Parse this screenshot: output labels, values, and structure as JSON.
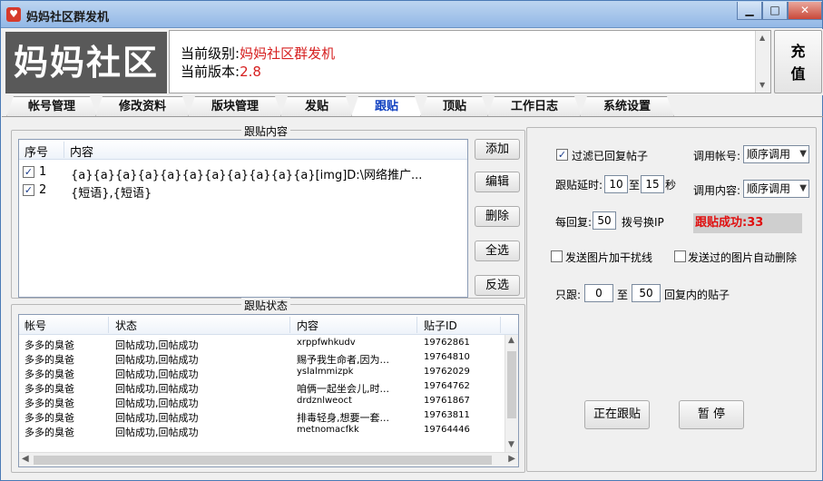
{
  "window": {
    "title": "妈妈社区群发机",
    "min_label": "▁",
    "max_label": "□",
    "close_label": "✕",
    "app_icon": "app-icon"
  },
  "header": {
    "logo": "妈妈社区",
    "level_label": "当前级别:",
    "level_value": "妈妈社区群发机",
    "version_label": "当前版本:",
    "version_value": "2.8",
    "recharge_label_1": "充",
    "recharge_label_2": "值"
  },
  "tabs": [
    "帐号管理",
    "修改资料",
    "版块管理",
    "发贴",
    "跟贴",
    "顶贴",
    "工作日志",
    "系统设置"
  ],
  "active_tab": "跟贴",
  "reply_content": {
    "title": "跟贴内容",
    "columns": [
      "序号",
      "内容"
    ],
    "rows": [
      {
        "no": "1",
        "checked": "✓",
        "content": "{a}{a}{a}{a}{a}{a}{a}{a}{a}{a}{a}[img]D:\\网络推广..."
      },
      {
        "no": "2",
        "checked": "✓",
        "content": "{短语},{短语}"
      }
    ],
    "buttons": {
      "add": "添加",
      "edit": "编辑",
      "delete": "删除",
      "select_all": "全选",
      "invert": "反选"
    }
  },
  "reply_status": {
    "title": "跟贴状态",
    "columns": [
      "帐号",
      "状态",
      "内容",
      "贴子ID"
    ],
    "rows": [
      {
        "account": "多多的臭爸",
        "status": "回帖成功,回帖成功",
        "content": "xrppfwhkudv",
        "post_id": "19762861"
      },
      {
        "account": "多多的臭爸",
        "status": "回帖成功,回帖成功",
        "content": "赐予我生命者,因为...",
        "post_id": "19764810"
      },
      {
        "account": "多多的臭爸",
        "status": "回帖成功,回帖成功",
        "content": "yslalmmizpk",
        "post_id": "19762029"
      },
      {
        "account": "多多的臭爸",
        "status": "回帖成功,回帖成功",
        "content": "咱俩一起坐会儿,时...",
        "post_id": "19764762"
      },
      {
        "account": "多多的臭爸",
        "status": "回帖成功,回帖成功",
        "content": "drdznlweoct",
        "post_id": "19761867"
      },
      {
        "account": "多多的臭爸",
        "status": "回帖成功,回帖成功",
        "content": "排毒轻身,想要一套...",
        "post_id": "19763811"
      },
      {
        "account": "多多的臭爸",
        "status": "回帖成功,回帖成功",
        "content": "metnomacfkk",
        "post_id": "19764446"
      }
    ]
  },
  "settings": {
    "filter_replied": {
      "label": "过滤已回复帖子",
      "checked": "✓"
    },
    "use_account_label": "调用帐号:",
    "use_account_value": "顺序调用",
    "delay_label": "跟贴延时:",
    "delay_min": "10",
    "delay_to": "至",
    "delay_max": "15",
    "delay_unit": "秒",
    "use_content_label": "调用内容:",
    "use_content_value": "顺序调用",
    "per_reply_label": "每回复:",
    "per_reply_value": "50",
    "redial_label": "拨号换IP",
    "success_text": "跟贴成功:33",
    "add_noise": {
      "label": "发送图片加干扰线",
      "checked": ""
    },
    "auto_delete": {
      "label": "发送过的图片自动删除",
      "checked": ""
    },
    "only_follow_label": "只跟:",
    "only_follow_min": "0",
    "only_follow_to": "至",
    "only_follow_max": "50",
    "only_follow_suffix": "回复内的贴子",
    "running_button": "正在跟贴",
    "pause_button": "暂 停"
  }
}
